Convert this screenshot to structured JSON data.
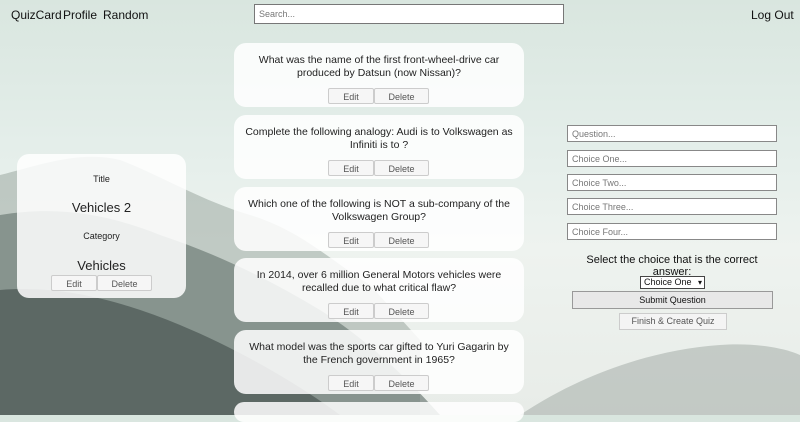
{
  "nav": {
    "brand": "QuizCard",
    "profile": "Profile",
    "random": "Random",
    "logout": "Log Out"
  },
  "search": {
    "placeholder": "Search..."
  },
  "questions": [
    {
      "text": "What was the name of the first front-wheel-drive car produced by Datsun (now Nissan)?",
      "edit": "Edit",
      "delete": "Delete"
    },
    {
      "text": "Complete the following analogy: Audi is to Volkswagen as Infiniti is to ?",
      "edit": "Edit",
      "delete": "Delete"
    },
    {
      "text": "Which one of the following is NOT a sub-company of the Volkswagen Group?",
      "edit": "Edit",
      "delete": "Delete"
    },
    {
      "text": "In 2014, over 6 million General Motors vehicles were recalled due to what critical flaw?",
      "edit": "Edit",
      "delete": "Delete"
    },
    {
      "text": "What model was the sports car gifted to Yuri Gagarin by the French government in 1965?",
      "edit": "Edit",
      "delete": "Delete"
    }
  ],
  "quiz": {
    "title_label": "Title",
    "title_value": "Vehicles 2",
    "category_label": "Category",
    "category_value": "Vehicles",
    "edit": "Edit",
    "delete": "Delete"
  },
  "form": {
    "question_placeholder": "Question...",
    "choice1_placeholder": "Choice One...",
    "choice2_placeholder": "Choice Two...",
    "choice3_placeholder": "Choice Three...",
    "choice4_placeholder": "Choice Four...",
    "prompt": "Select the choice that is the correct answer:",
    "selected_choice": "Choice One",
    "submit": "Submit Question",
    "finish": "Finish & Create Quiz"
  }
}
